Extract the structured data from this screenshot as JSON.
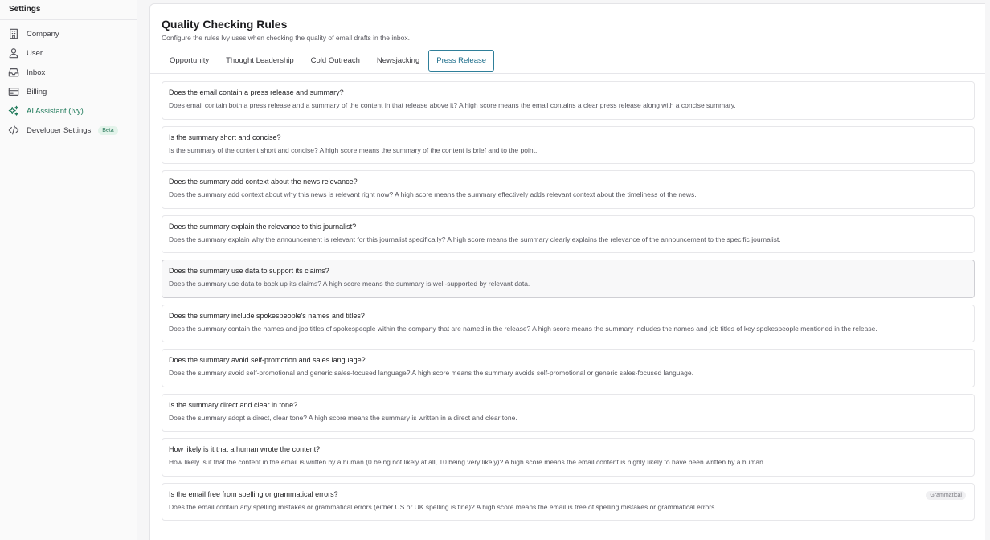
{
  "sidebar": {
    "title": "Settings",
    "items": [
      {
        "label": "Company",
        "icon": "building-icon"
      },
      {
        "label": "User",
        "icon": "user-icon"
      },
      {
        "label": "Inbox",
        "icon": "inbox-icon"
      },
      {
        "label": "Billing",
        "icon": "credit-card-icon"
      },
      {
        "label": "AI Assistant (Ivy)",
        "icon": "sparkles-icon",
        "active": true
      },
      {
        "label": "Developer Settings",
        "icon": "code-icon",
        "badge": "Beta"
      }
    ]
  },
  "page": {
    "title": "Quality Checking Rules",
    "subtitle": "Configure the rules Ivy uses when checking the quality of email drafts in the inbox."
  },
  "tabs": [
    "Opportunity",
    "Thought Leadership",
    "Cold Outreach",
    "Newsjacking",
    "Press Release"
  ],
  "active_tab": "Press Release",
  "rules": [
    {
      "title": "Does the email contain a press release and summary?",
      "desc": "Does email contain both a press release and a summary of the content in that release above it? A high score means the email contains a clear press release along with a concise summary."
    },
    {
      "title": "Is the summary short and concise?",
      "desc": "Is the summary of the content short and concise? A high score means the summary of the content is brief and to the point."
    },
    {
      "title": "Does the summary add context about the news relevance?",
      "desc": "Does the summary add context about why this news is relevant right now? A high score means the summary effectively adds relevant context about the timeliness of the news."
    },
    {
      "title": "Does the summary explain the relevance to this journalist?",
      "desc": "Does the summary explain why the announcement is relevant for this journalist specifically? A high score means the summary clearly explains the relevance of the announcement to the specific journalist."
    },
    {
      "title": "Does the summary use data to support its claims?",
      "desc": "Does the summary use data to back up its claims? A high score means the summary is well-supported by relevant data."
    },
    {
      "title": "Does the summary include spokespeople's names and titles?",
      "desc": "Does the summary contain the names and job titles of spokespeople within the company that are named in the release? A high score means the summary includes the names and job titles of key spokespeople mentioned in the release."
    },
    {
      "title": "Does the summary avoid self-promotion and sales language?",
      "desc": "Does the summary avoid self-promotional and generic sales-focused language? A high score means the summary avoids self-promotional or generic sales-focused language."
    },
    {
      "title": "Is the summary direct and clear in tone?",
      "desc": "Does the summary adopt a direct, clear tone? A high score means the summary is written in a direct and clear tone."
    },
    {
      "title": "How likely is it that a human wrote the content?",
      "desc": "How likely is it that the content in the email is written by a human (0 being not likely at all, 10 being very likely)? A high score means the email content is highly likely to have been written by a human."
    },
    {
      "title": "Is the email free from spelling or grammatical errors?",
      "desc": "Does the email contain any spelling mistakes or grammatical errors (either US or UK spelling is fine)? A high score means the email is free of spelling mistakes or grammatical errors.",
      "tag": "Grammatical"
    }
  ]
}
